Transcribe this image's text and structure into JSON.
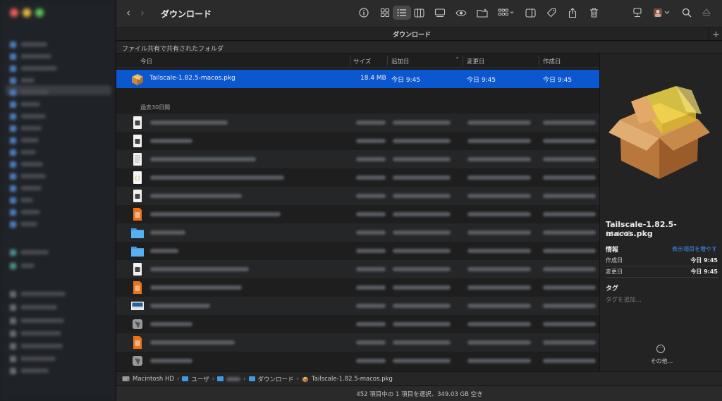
{
  "window": {
    "title": "ダウンロード",
    "tab_title": "ダウンロード",
    "tab_add": "+",
    "shared_bar_label": "ファイル共有で共有されたフォルダ"
  },
  "toolbar": {
    "back": "‹",
    "forward": "›"
  },
  "columns": {
    "name": "今日",
    "size": "サイズ",
    "added": "追加日",
    "modified": "変更日",
    "created": "作成日",
    "sort_indicator": "⌃"
  },
  "selected_file": {
    "name": "Tailscale-1.82.5-macos.pkg",
    "size": "18.4 MB",
    "added": "今日 9:45",
    "modified": "今日 9:45",
    "created": "今日 9:45"
  },
  "group_label": "過去30日間",
  "preview": {
    "name": "Tailscale-1.82.5-macos.pkg",
    "size": "18.4 MB",
    "info_label": "情報",
    "show_more": "表示項目を増やす",
    "created_label": "作成日",
    "created_value": "今日 9:45",
    "modified_label": "変更日",
    "modified_value": "今日 9:45",
    "tags_label": "タグ",
    "tags_placeholder": "タグを追加…",
    "other_label": "その他..."
  },
  "pathbar": {
    "disk": "Macintosh HD",
    "users": "ユーザ",
    "downloads": "ダウンロード",
    "file": "Tailscale-1.82.5-macos.pkg",
    "separator": "›"
  },
  "status": {
    "text": "452 項目中の 1 項目を選択、349.03 GB 空き"
  },
  "colors": {
    "selection": "#0a57d0",
    "link": "#3d8ef0",
    "folder": "#3b9be5"
  }
}
